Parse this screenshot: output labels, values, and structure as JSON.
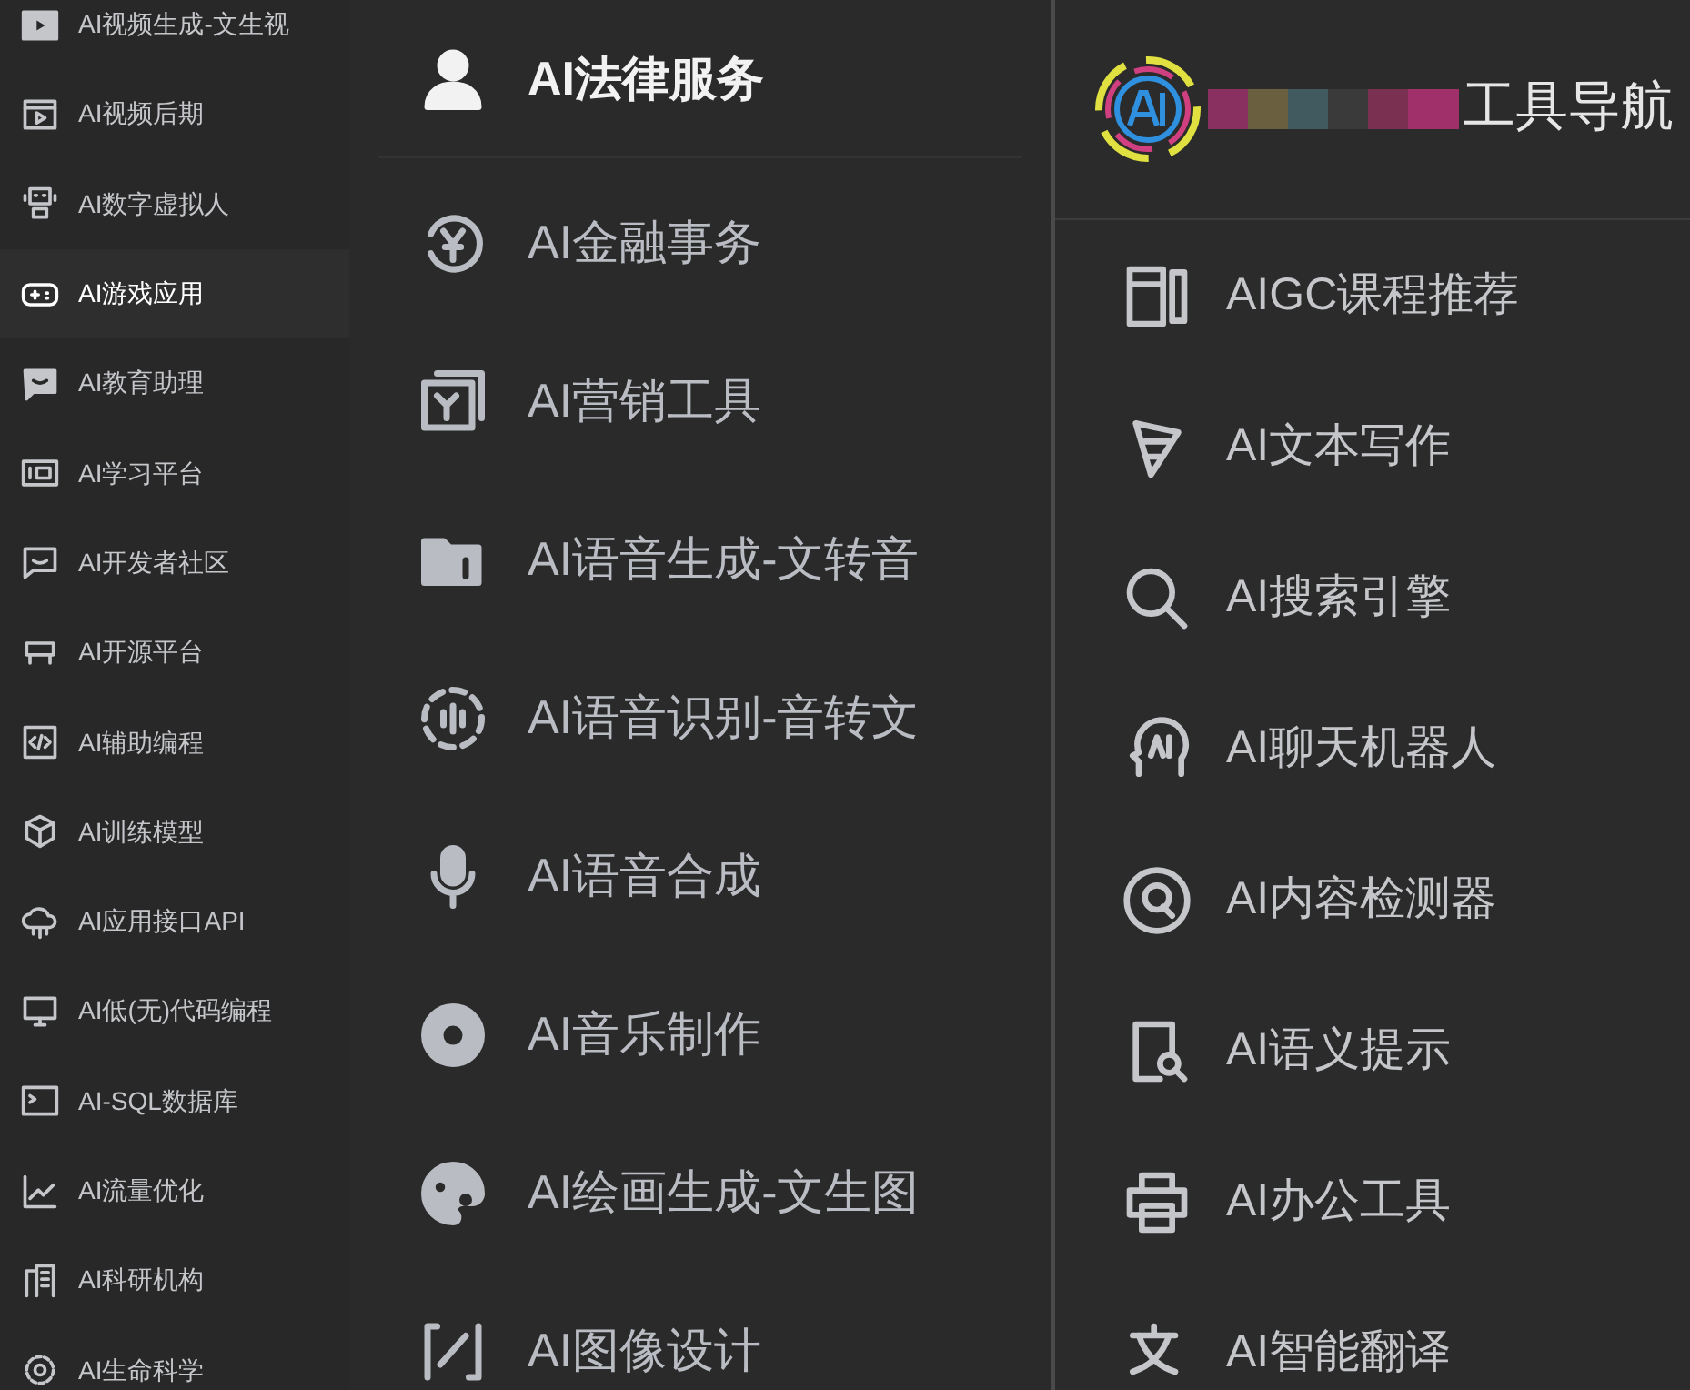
{
  "left_menu": {
    "items": [
      {
        "label": "AI视频生成-文生视",
        "selected": false
      },
      {
        "label": "AI视频后期",
        "selected": false
      },
      {
        "label": "AI数字虚拟人",
        "selected": false
      },
      {
        "label": "AI游戏应用",
        "selected": true
      },
      {
        "label": "AI教育助理",
        "selected": false
      },
      {
        "label": "AI学习平台",
        "selected": false
      },
      {
        "label": "AI开发者社区",
        "selected": false
      },
      {
        "label": "AI开源平台",
        "selected": false
      },
      {
        "label": "AI辅助编程",
        "selected": false
      },
      {
        "label": "AI训练模型",
        "selected": false
      },
      {
        "label": "AI应用接口API",
        "selected": false
      },
      {
        "label": "AI低(无)代码编程",
        "selected": false
      },
      {
        "label": "AI-SQL数据库",
        "selected": false
      },
      {
        "label": "AI流量优化",
        "selected": false
      },
      {
        "label": "AI科研机构",
        "selected": false
      },
      {
        "label": "AI生命科学",
        "selected": false
      }
    ]
  },
  "middle_menu": {
    "items": [
      {
        "label": "AI法律服务",
        "selected": true
      },
      {
        "label": "AI金融事务",
        "selected": false
      },
      {
        "label": "AI营销工具",
        "selected": false
      },
      {
        "label": "AI语音生成-文转音",
        "selected": false
      },
      {
        "label": "AI语音识别-音转文",
        "selected": false
      },
      {
        "label": "AI语音合成",
        "selected": false
      },
      {
        "label": "AI音乐制作",
        "selected": false
      },
      {
        "label": "AI绘画生成-文生图",
        "selected": false
      },
      {
        "label": "AI图像设计",
        "selected": false
      }
    ]
  },
  "right_menu": {
    "header": {
      "title": "工具导航"
    },
    "items": [
      {
        "label": "AIGC课程推荐"
      },
      {
        "label": "AI文本写作"
      },
      {
        "label": "AI搜索引擎"
      },
      {
        "label": "AI聊天机器人"
      },
      {
        "label": "AI内容检测器"
      },
      {
        "label": "AI语义提示"
      },
      {
        "label": "AI办公工具"
      },
      {
        "label": "AI智能翻译"
      }
    ]
  }
}
